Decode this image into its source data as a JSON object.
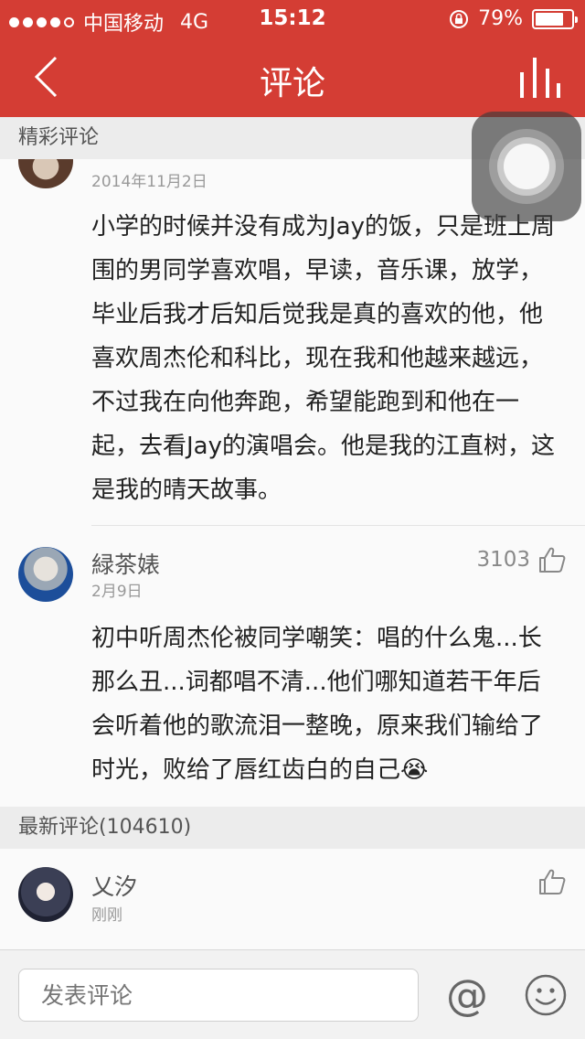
{
  "status_bar": {
    "carrier": "中国移动",
    "network": "4G",
    "time": "15:12",
    "battery_percent": "79%",
    "battery_level": 0.79
  },
  "nav": {
    "title": "评论",
    "back_icon": "chevron-left-icon",
    "stats_icon": "bars-icon"
  },
  "sections": {
    "featured_title": "精彩评论",
    "latest_title": "最新评论(104610)"
  },
  "featured_comments": [
    {
      "date": "2014年11月2日",
      "text": "小学的时候并没有成为Jay的饭，只是班上周围的男同学喜欢唱，早读，音乐课，放学，毕业后我才后知后觉我是真的喜欢的他，他喜欢周杰伦和科比，现在我和他越来越远，不过我在向他奔跑，希望能跑到和他在一起，去看Jay的演唱会。他是我的江直树，这是我的晴天故事。"
    },
    {
      "user": "緑茶婊",
      "date": "2月9日",
      "likes": "3103",
      "text": "初中听周杰伦被同学嘲笑：唱的什么鬼...长那么丑...词都唱不清...他们哪知道若干年后会听着他的歌流泪一整晚，原来我们输给了时光，败给了唇红齿白的自己😭"
    }
  ],
  "latest_comments": [
    {
      "user": "乂汐",
      "date": "刚刚"
    }
  ],
  "footer": {
    "input_placeholder": "发表评论",
    "at_symbol": "@"
  },
  "colors": {
    "brand_red": "#d43d34",
    "section_bg": "#ececec"
  }
}
